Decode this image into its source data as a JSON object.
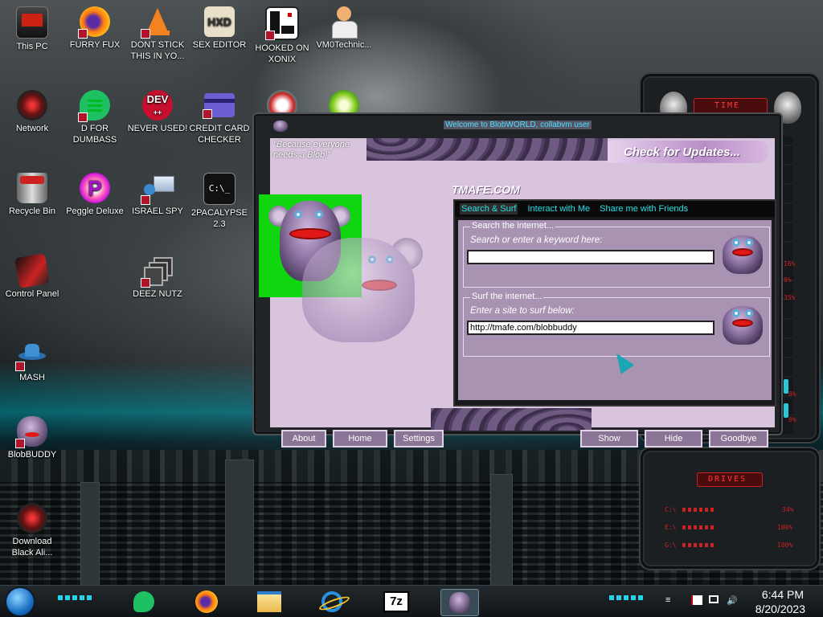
{
  "desktop": {
    "icons": [
      {
        "label": "This PC"
      },
      {
        "label": "FURRY FUX"
      },
      {
        "label": "DONT STICK\nTHIS IN YO..."
      },
      {
        "label": "SEX EDITOR"
      },
      {
        "label": "HOOKED ON\nXONIX"
      },
      {
        "label": "VM0Technic..."
      },
      {
        "label": "Network"
      },
      {
        "label": "D FOR\nDUMBASS"
      },
      {
        "label": "NEVER USED!"
      },
      {
        "label": "CREDIT CARD\nCHECKER"
      },
      {
        "label": "Recycle Bin"
      },
      {
        "label": "Peggle Deluxe"
      },
      {
        "label": "ISRAEL SPY"
      },
      {
        "label": "2PACALYPSE\n2.3"
      },
      {
        "label": "Control Panel"
      },
      {
        "label": "DEEZ NUTZ"
      },
      {
        "label": "MASH"
      },
      {
        "label": "BlobBUDDY"
      },
      {
        "label": "Download\nBlack Ali..."
      }
    ],
    "icon_texts": {
      "dev_badge": "DEV",
      "dev_plus": "++",
      "terminal": "C:\\_",
      "hex": "HXD",
      "p_letter": "P"
    }
  },
  "gadget": {
    "time_title": "TIME",
    "drives_title": "DRIVES",
    "cpu_pcts": [
      "16%",
      "8%",
      "35%",
      "8%",
      "8%"
    ],
    "drives": [
      {
        "letter": "C:\\",
        "pct": "34%"
      },
      {
        "letter": "E:\\",
        "pct": "100%"
      },
      {
        "letter": "G:\\",
        "pct": "100%"
      }
    ]
  },
  "app": {
    "title": "Welcome to BlobWORLD, collabvm user",
    "tagline": "\"Because everyone needs a Blob!\"",
    "updates_button": "Check for Updates...",
    "brand": "TMAFE.COM",
    "tabs": [
      "Search & Surf",
      "Interact with Me",
      "Share me with Friends"
    ],
    "search_group": {
      "title": "Search the internet...",
      "hint": "Search or enter a keyword here:",
      "value": ""
    },
    "surf_group": {
      "title": "Surf the internet...",
      "hint": "Enter a site to surf below:",
      "value": "http://tmafe.com/blobbuddy"
    },
    "buttons": {
      "about": "About",
      "home": "Home",
      "settings": "Settings",
      "show": "Show",
      "hide": "Hide",
      "goodbye": "Goodbye"
    }
  },
  "taskbar": {
    "time": "6:44 PM",
    "date": "8/20/2023",
    "pinned": [
      "feedly-icon",
      "firefox-icon",
      "file-explorer-icon",
      "internet-explorer-icon",
      "7zip-icon",
      "blobbuddy-icon"
    ],
    "seven_zip_label": "7z"
  },
  "colors": {
    "accent_cyan": "#27e0e6",
    "app_lavender": "#d9c4dd",
    "panel_purple": "#a893b3",
    "green_screen": "#0fd60f",
    "gadget_red": "#b81a1a"
  }
}
